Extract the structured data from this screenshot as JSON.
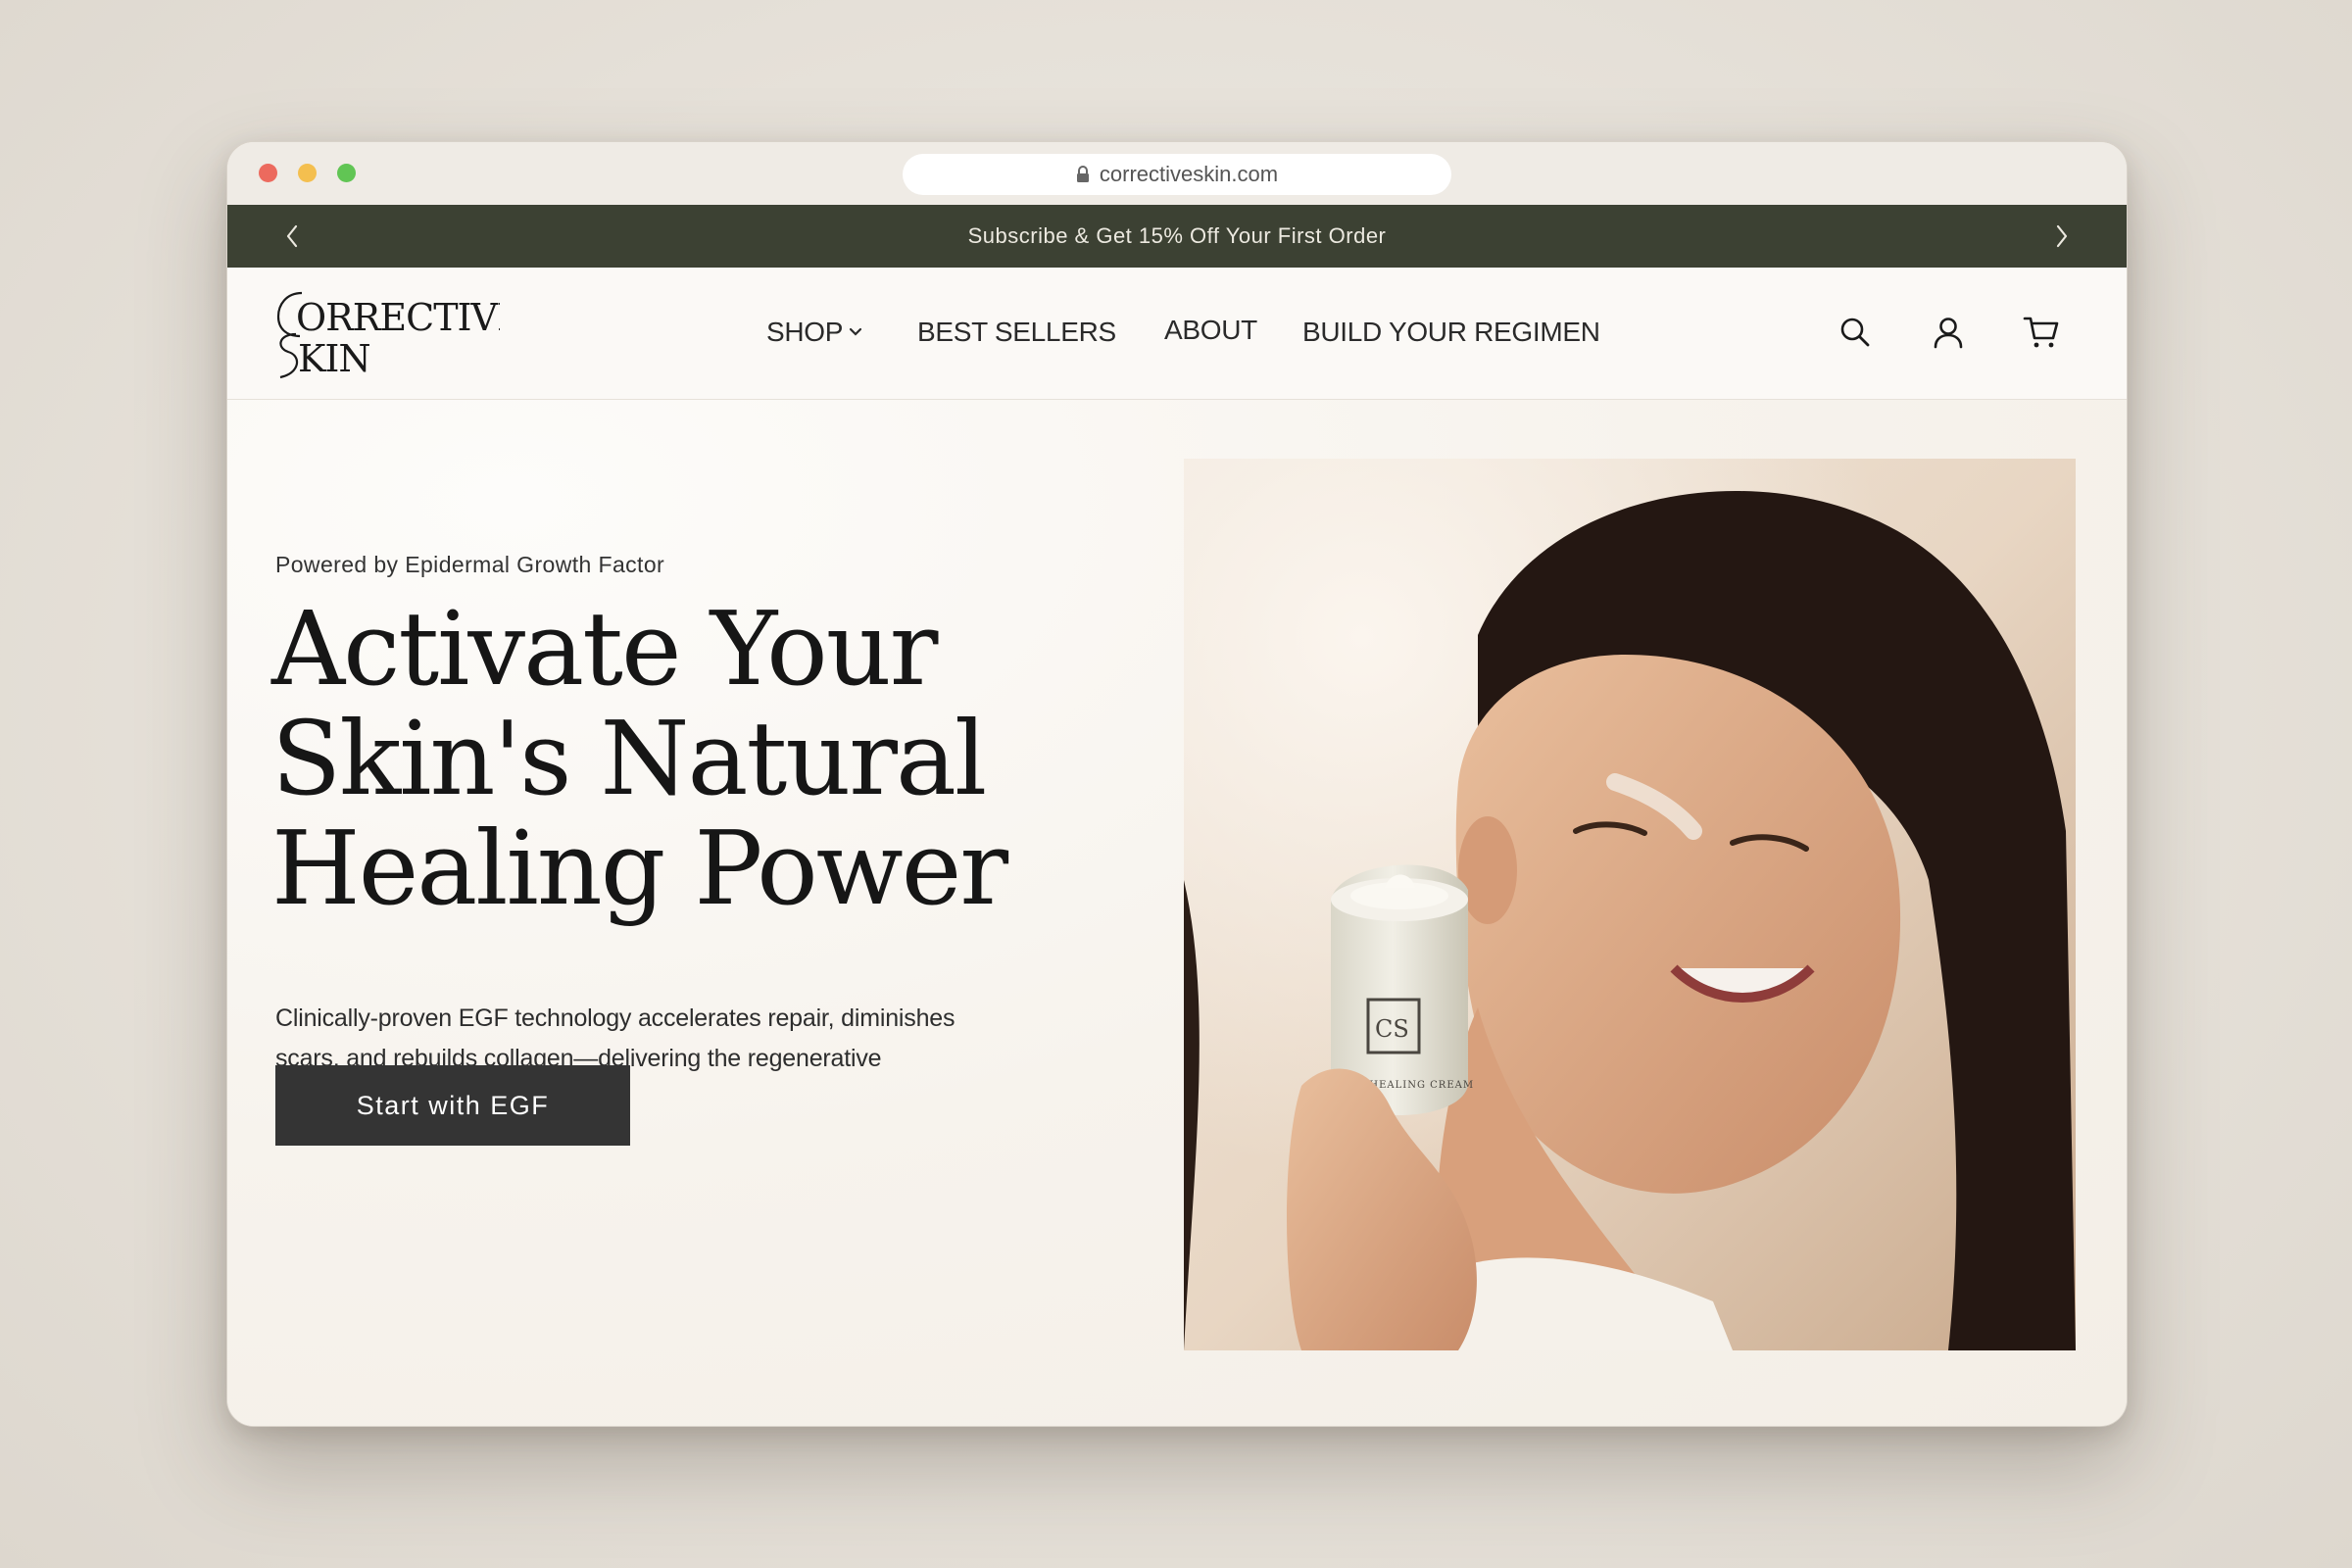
{
  "browser": {
    "url": "correctiveskin.com"
  },
  "announcement": {
    "text": "Subscribe & Get 15% Off Your First Order"
  },
  "brand": {
    "logo_line1": "CORRECTIVE",
    "logo_line2": "SKIN"
  },
  "nav": {
    "items": [
      {
        "label": "SHOP",
        "has_dropdown": true
      },
      {
        "label": "BEST SELLERS"
      },
      {
        "label": "ABOUT"
      },
      {
        "label": "BUILD YOUR REGIMEN"
      }
    ],
    "icons": [
      "search-icon",
      "account-icon",
      "cart-icon"
    ]
  },
  "hero": {
    "eyebrow": "Powered by Epidermal Growth Factor",
    "headline_lines": [
      "Activate Your",
      "Skin's Natural",
      "Healing Power"
    ],
    "body": "Clinically-proven EGF technology accelerates repair, diminishes scars, and rebuilds collagen—delivering the regenerative treatment dermatologists trust.",
    "cta_label": "Start with EGF",
    "image_jar_label": "EGF HEALING CREAM",
    "image_jar_monogram": "CS"
  },
  "colors": {
    "announcement_bg": "#3c4133",
    "cta_bg": "#343434",
    "page_bg": "#f6f2ec"
  }
}
